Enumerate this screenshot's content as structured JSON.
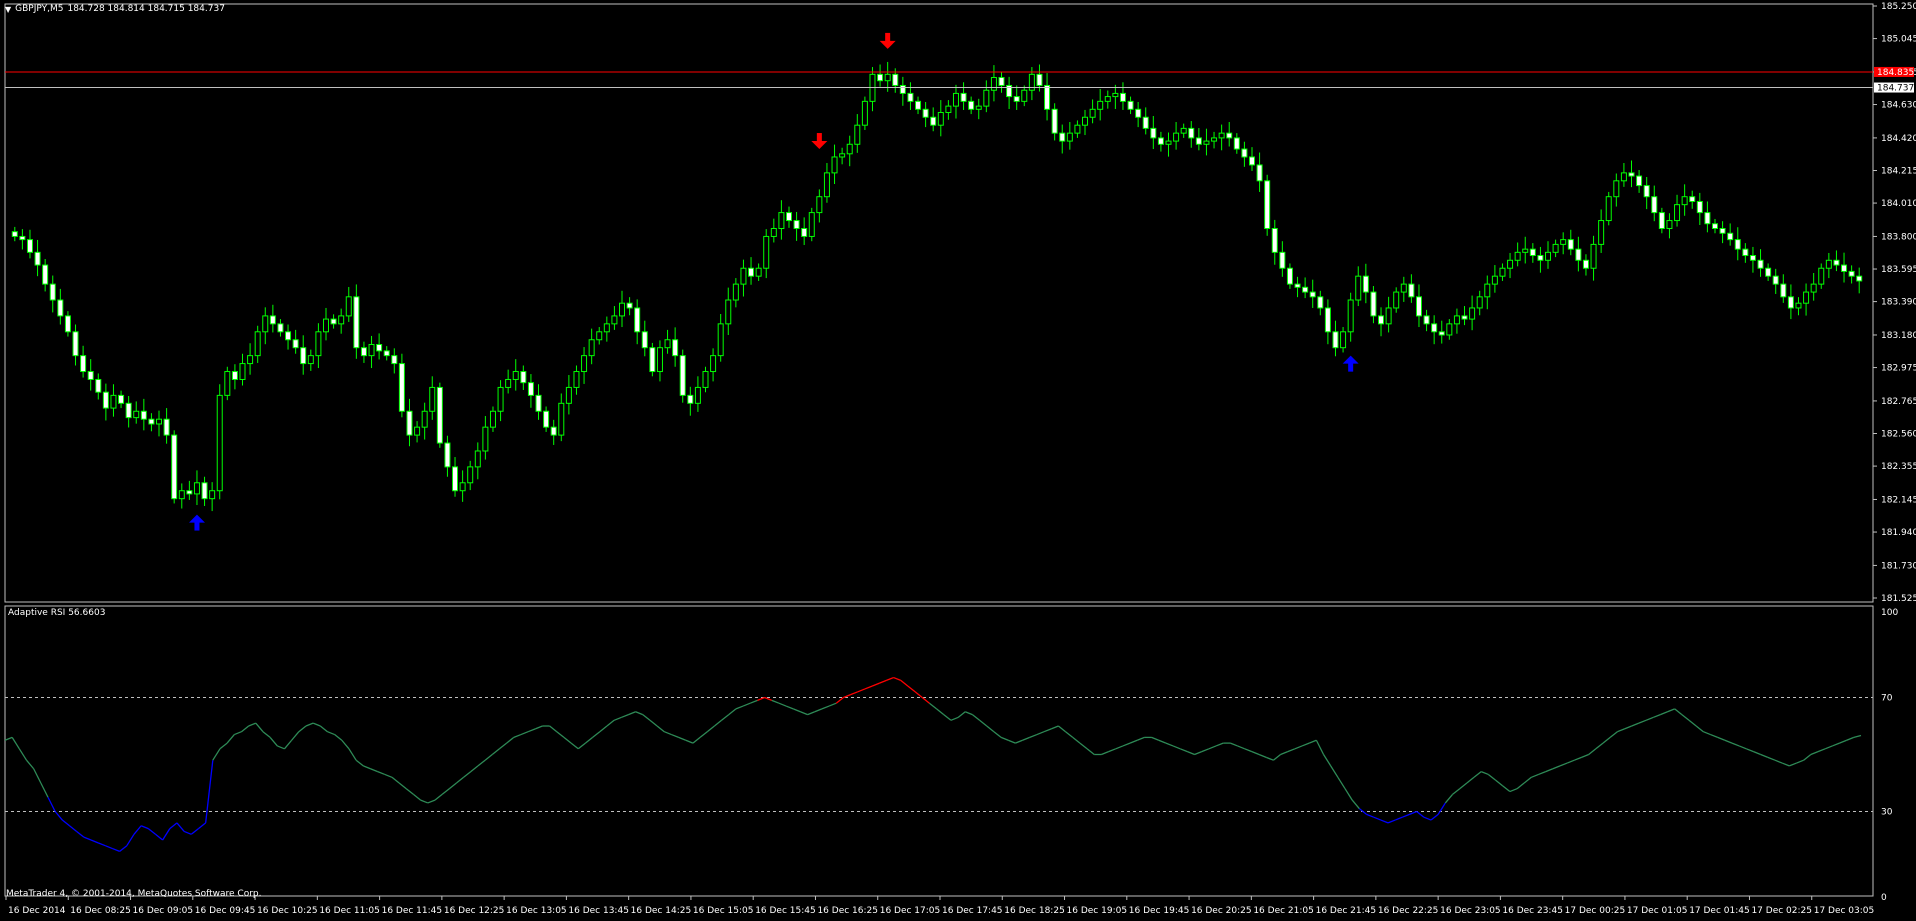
{
  "terminal": {
    "symbol": "GBPJPY,M5",
    "ohlc": "184.728 184.814 184.715 184.737",
    "indicator_name": "Adaptive RSI",
    "indicator_value": "56.6603",
    "copyright": "MetaTrader 4, © 2001-2014, MetaQuotes Software Corp."
  },
  "colors": {
    "background": "#000000",
    "candle_up": "#000000",
    "candle_down": "#ffffff",
    "candle_outline": "#00ff00",
    "bid_line": "#ff0000",
    "ask_line": "#c0c0c0",
    "signal_down": "#ff0000",
    "signal_up": "#0000ff",
    "rsi_normal": "#2e8b57",
    "rsi_oversold": "#0000ff",
    "rsi_overbought": "#ff0000"
  },
  "price_axis": {
    "labels": [
      "185.250",
      "185.045",
      "184.835",
      "184.630",
      "184.420",
      "184.215",
      "184.010",
      "183.800",
      "183.595",
      "183.390",
      "183.180",
      "182.975",
      "182.765",
      "182.560",
      "182.355",
      "182.145",
      "181.940",
      "181.730",
      "181.525"
    ],
    "bid_label": "184.835",
    "current_label": "184.737"
  },
  "rsi_axis": {
    "labels": [
      "100",
      "70",
      "30",
      "0"
    ]
  },
  "time_axis": [
    "16 Dec 2014",
    "16 Dec 08:25",
    "16 Dec 09:05",
    "16 Dec 09:45",
    "16 Dec 10:25",
    "16 Dec 11:05",
    "16 Dec 11:45",
    "16 Dec 12:25",
    "16 Dec 13:05",
    "16 Dec 13:45",
    "16 Dec 14:25",
    "16 Dec 15:05",
    "16 Dec 15:45",
    "16 Dec 16:25",
    "16 Dec 17:05",
    "16 Dec 17:45",
    "16 Dec 18:25",
    "16 Dec 19:05",
    "16 Dec 19:45",
    "16 Dec 20:25",
    "16 Dec 21:05",
    "16 Dec 21:45",
    "16 Dec 22:25",
    "16 Dec 23:05",
    "16 Dec 23:45",
    "17 Dec 00:25",
    "17 Dec 01:05",
    "17 Dec 01:45",
    "17 Dec 02:25",
    "17 Dec 03:05"
  ],
  "chart_data": [
    {
      "type": "candlestick",
      "title": "GBPJPY,M5",
      "ylim": [
        181.525,
        185.25
      ],
      "bid": 184.835,
      "current": 184.737,
      "closes": [
        183.8,
        183.78,
        183.7,
        183.62,
        183.5,
        183.4,
        183.3,
        183.2,
        183.05,
        182.95,
        182.9,
        182.82,
        182.72,
        182.8,
        182.75,
        182.66,
        182.7,
        182.65,
        182.62,
        182.65,
        182.55,
        182.15,
        182.2,
        182.18,
        182.25,
        182.15,
        182.2,
        182.8,
        182.95,
        182.9,
        183.0,
        183.05,
        183.2,
        183.3,
        183.25,
        183.2,
        183.15,
        183.1,
        183.0,
        183.05,
        183.2,
        183.28,
        183.25,
        183.3,
        183.42,
        183.1,
        183.05,
        183.12,
        183.08,
        183.05,
        183.0,
        182.7,
        182.55,
        182.6,
        182.7,
        182.85,
        182.5,
        182.35,
        182.2,
        182.25,
        182.35,
        182.45,
        182.6,
        182.7,
        182.85,
        182.9,
        182.95,
        182.88,
        182.8,
        182.7,
        182.6,
        182.55,
        182.75,
        182.85,
        182.95,
        183.05,
        183.15,
        183.2,
        183.25,
        183.3,
        183.38,
        183.35,
        183.2,
        183.1,
        182.95,
        183.1,
        183.15,
        183.05,
        182.8,
        182.75,
        182.85,
        182.95,
        183.05,
        183.25,
        183.4,
        183.5,
        183.6,
        183.55,
        183.6,
        183.8,
        183.85,
        183.95,
        183.9,
        183.85,
        183.8,
        183.95,
        184.05,
        184.2,
        184.3,
        184.32,
        184.38,
        184.5,
        184.65,
        184.82,
        184.78,
        184.82,
        184.75,
        184.7,
        184.65,
        184.6,
        184.55,
        184.5,
        184.58,
        184.62,
        184.7,
        184.65,
        184.6,
        184.62,
        184.72,
        184.8,
        184.75,
        184.68,
        184.65,
        184.72,
        184.82,
        184.75,
        184.6,
        184.45,
        184.4,
        184.45,
        184.5,
        184.55,
        184.6,
        184.65,
        184.68,
        184.7,
        184.65,
        184.6,
        184.55,
        184.48,
        184.42,
        184.38,
        184.4,
        184.45,
        184.48,
        184.42,
        184.38,
        184.4,
        184.42,
        184.45,
        184.42,
        184.35,
        184.3,
        184.25,
        184.15,
        183.85,
        183.7,
        183.6,
        183.5,
        183.48,
        183.45,
        183.42,
        183.35,
        183.2,
        183.1,
        183.2,
        183.4,
        183.55,
        183.45,
        183.3,
        183.25,
        183.35,
        183.45,
        183.5,
        183.42,
        183.3,
        183.25,
        183.2,
        183.18,
        183.25,
        183.3,
        183.28,
        183.35,
        183.42,
        183.5,
        183.55,
        183.6,
        183.65,
        183.7,
        183.72,
        183.68,
        183.65,
        183.7,
        183.75,
        183.78,
        183.72,
        183.65,
        183.6,
        183.75,
        183.9,
        184.05,
        184.15,
        184.2,
        184.18,
        184.12,
        184.05,
        183.95,
        183.85,
        183.9,
        184.0,
        184.05,
        184.02,
        183.95,
        183.88,
        183.85,
        183.82,
        183.78,
        183.72,
        183.68,
        183.65,
        183.6,
        183.55,
        183.5,
        183.42,
        183.35,
        183.38,
        183.45,
        183.5,
        183.6,
        183.65,
        183.62,
        183.58,
        183.55,
        183.52
      ]
    },
    {
      "type": "line",
      "title": "Adaptive RSI 56.6603",
      "ylim": [
        0,
        100
      ],
      "levels": [
        70,
        30
      ],
      "values": [
        55,
        56,
        52,
        48,
        45,
        40,
        35,
        30,
        27,
        25,
        23,
        21,
        20,
        19,
        18,
        17,
        16,
        18,
        22,
        25,
        24,
        22,
        20,
        24,
        26,
        23,
        22,
        24,
        26,
        48,
        52,
        54,
        57,
        58,
        60,
        61,
        58,
        56,
        53,
        52,
        55,
        58,
        60,
        61,
        60,
        58,
        57,
        55,
        52,
        48,
        46,
        45,
        44,
        43,
        42,
        40,
        38,
        36,
        34,
        33,
        34,
        36,
        38,
        40,
        42,
        44,
        46,
        48,
        50,
        52,
        54,
        56,
        57,
        58,
        59,
        60,
        60,
        58,
        56,
        54,
        52,
        54,
        56,
        58,
        60,
        62,
        63,
        64,
        65,
        64,
        62,
        60,
        58,
        57,
        56,
        55,
        54,
        56,
        58,
        60,
        62,
        64,
        66,
        67,
        68,
        69,
        70,
        69,
        68,
        67,
        66,
        65,
        64,
        65,
        66,
        67,
        68,
        70,
        71,
        72,
        73,
        74,
        75,
        76,
        77,
        76,
        74,
        72,
        70,
        68,
        66,
        64,
        62,
        63,
        65,
        64,
        62,
        60,
        58,
        56,
        55,
        54,
        55,
        56,
        57,
        58,
        59,
        60,
        58,
        56,
        54,
        52,
        50,
        50,
        51,
        52,
        53,
        54,
        55,
        56,
        56,
        55,
        54,
        53,
        52,
        51,
        50,
        51,
        52,
        53,
        54,
        54,
        53,
        52,
        51,
        50,
        49,
        48,
        50,
        51,
        52,
        53,
        54,
        55,
        50,
        46,
        42,
        38,
        34,
        31,
        29,
        28,
        27,
        26,
        27,
        28,
        29,
        30,
        28,
        27,
        29,
        33,
        36,
        38,
        40,
        42,
        44,
        43,
        41,
        39,
        37,
        38,
        40,
        42,
        43,
        44,
        45,
        46,
        47,
        48,
        49,
        50,
        52,
        54,
        56,
        58,
        59,
        60,
        61,
        62,
        63,
        64,
        65,
        66,
        64,
        62,
        60,
        58,
        57,
        56,
        55,
        54,
        53,
        52,
        51,
        50,
        49,
        48,
        47,
        46,
        47,
        48,
        50,
        51,
        52,
        53,
        54,
        55,
        56,
        56.66
      ]
    }
  ]
}
